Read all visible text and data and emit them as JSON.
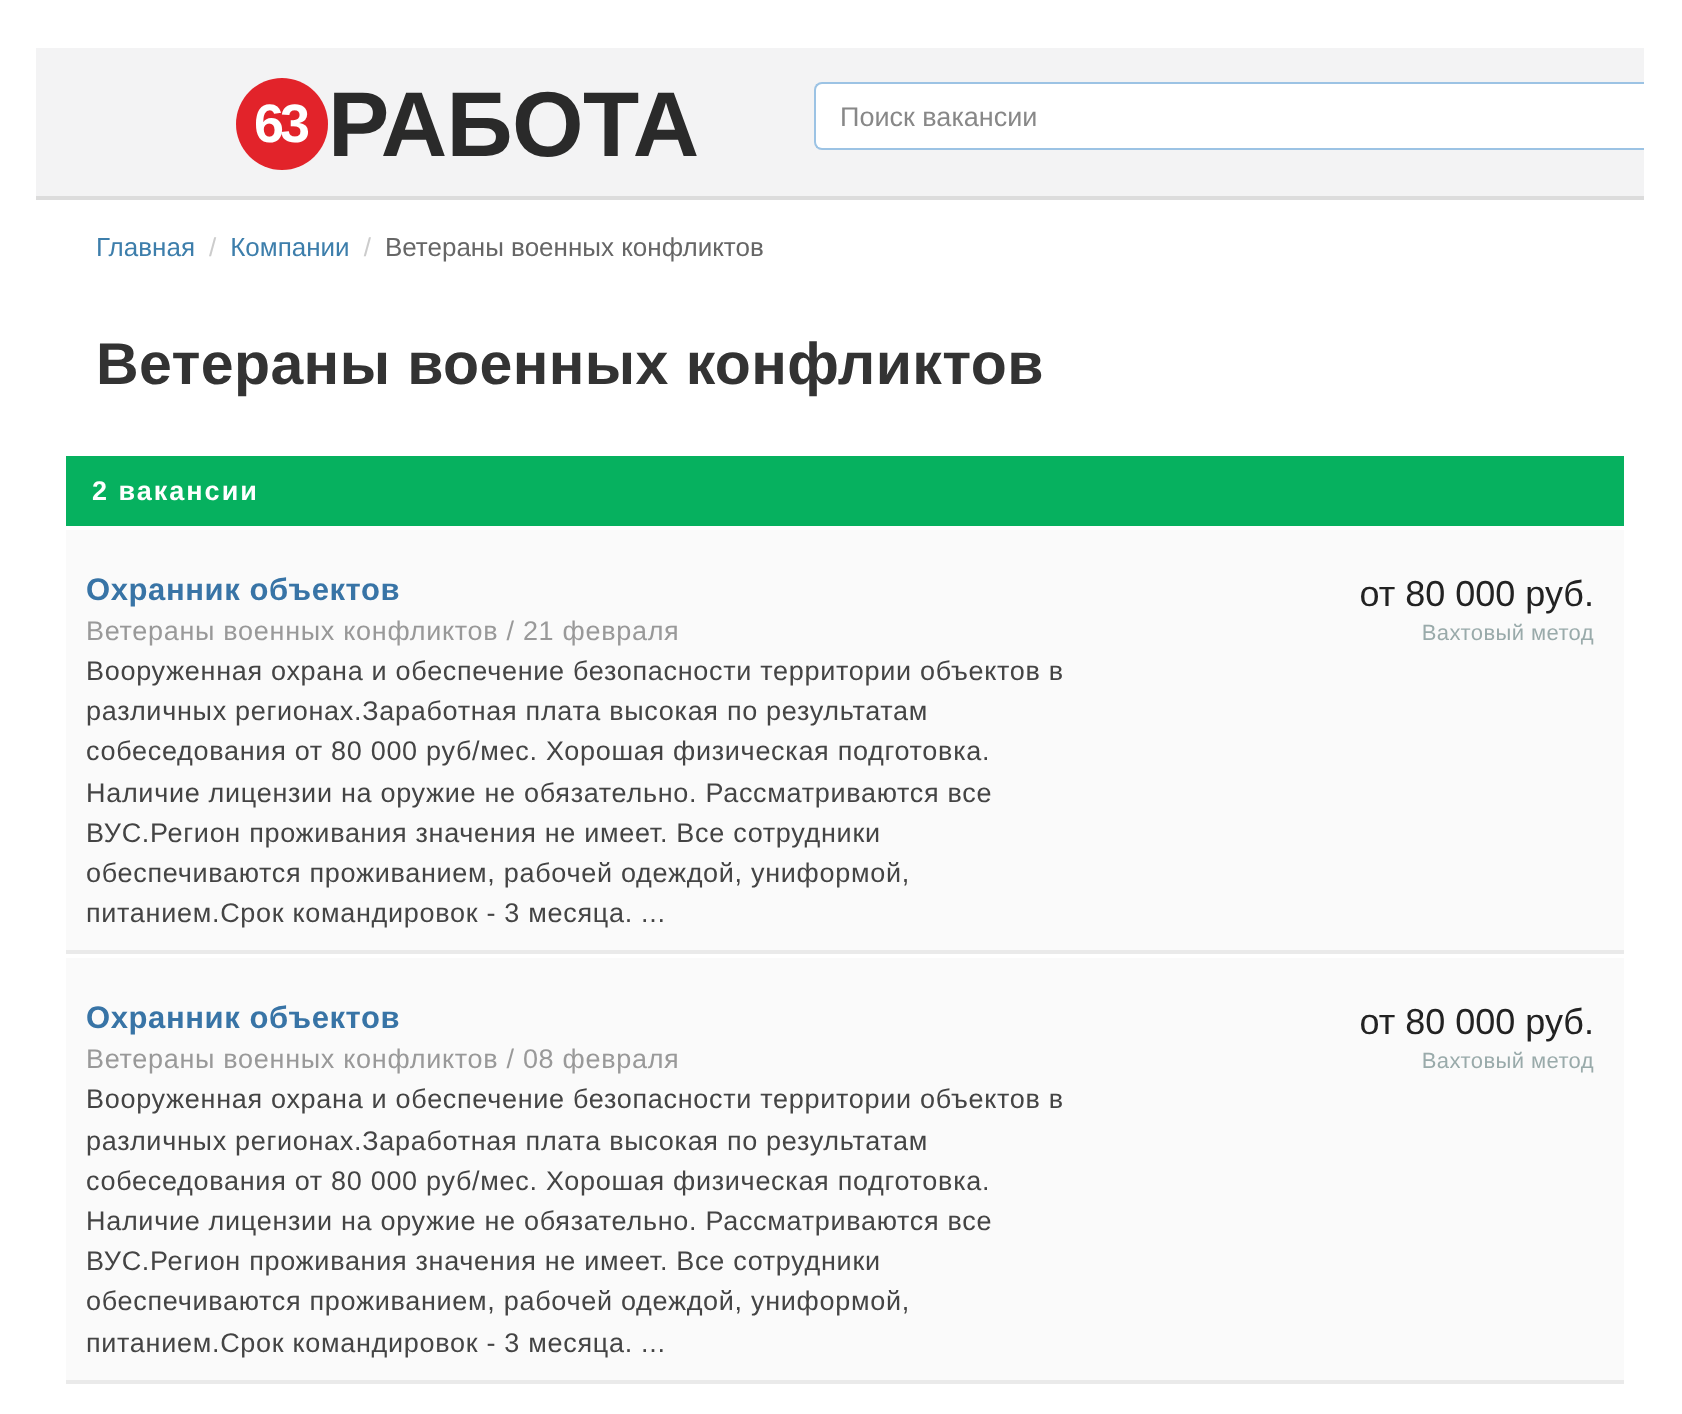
{
  "header": {
    "logo": {
      "badge": "63",
      "wordmark": "РАБОТА"
    },
    "search": {
      "placeholder": "Поиск вакансии"
    }
  },
  "breadcrumbs": {
    "separator": "/",
    "items": [
      {
        "label": "Главная",
        "kind": "link"
      },
      {
        "label": "Компании",
        "kind": "link"
      },
      {
        "label": "Ветераны военных конфликтов",
        "kind": "current"
      }
    ]
  },
  "page_title": "Ветераны военных конфликтов",
  "results_bar": {
    "count": "2 вакансии"
  },
  "vacancies": [
    {
      "title": "Охранник объектов",
      "meta": "Ветераны военных конфликтов / 21 февраля",
      "description": "Вооруженная охрана и обеспечение безопасности территории объектов в различных регионах.Заработная плата высокая по результатам собеседования от 80 000 руб/мес. Хорошая физическая подготовка. Наличие лицензии на оружие не обязательно. Рассматриваются все ВУС.Регион проживания значения не имеет. Все сотрудники обеспечиваются проживанием, рабочей одеждой, униформой, питанием.Срок командировок - 3 месяца. ...",
      "salary": "от 80 000 руб.",
      "schedule": "Вахтовый метод"
    },
    {
      "title": "Охранник объектов",
      "meta": "Ветераны военных конфликтов / 08 февраля",
      "description": "Вооруженная охрана и обеспечение безопасности территории объектов в различных регионах.Заработная плата высокая по результатам собеседования от 80 000 руб/мес. Хорошая физическая подготовка. Наличие лицензии на оружие не обязательно. Рассматриваются все ВУС.Регион проживания значения не имеет. Все сотрудники обеспечиваются проживанием, рабочей одеждой, униформой, питанием.Срок командировок - 3 месяца. ...",
      "salary": "от 80 000 руб.",
      "schedule": "Вахтовый метод"
    }
  ]
}
